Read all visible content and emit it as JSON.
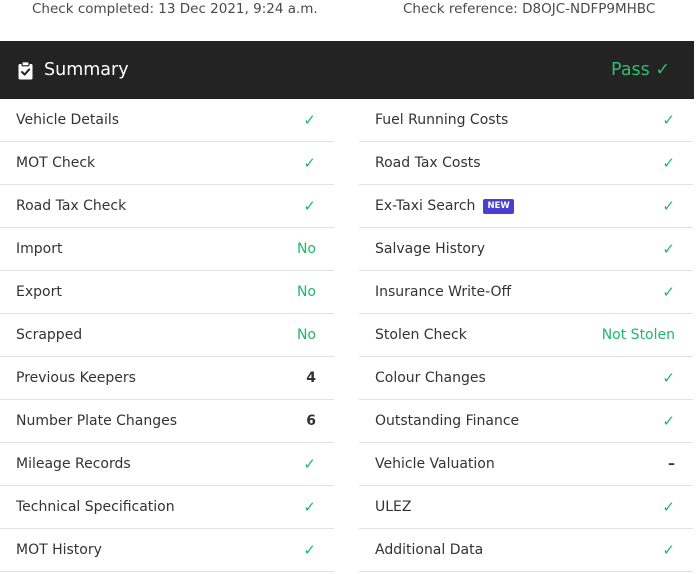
{
  "meta": {
    "completed": "Check completed: 13 Dec 2021, 9:24 a.m.",
    "reference": "Check reference: D8OJC-NDFP9MHBC"
  },
  "summary": {
    "title": "Summary",
    "status": "Pass ✓",
    "status_color": "#2dbf6e",
    "header_bg": "#232323",
    "icon": "clipboard-check-icon"
  },
  "left_rows": [
    {
      "label": "Vehicle Details",
      "value": "✓",
      "kind": "ok"
    },
    {
      "label": "MOT Check",
      "value": "✓",
      "kind": "ok"
    },
    {
      "label": "Road Tax Check",
      "value": "✓",
      "kind": "ok"
    },
    {
      "label": "Import",
      "value": "No",
      "kind": "green"
    },
    {
      "label": "Export",
      "value": "No",
      "kind": "green"
    },
    {
      "label": "Scrapped",
      "value": "No",
      "kind": "green"
    },
    {
      "label": "Previous Keepers",
      "value": "4",
      "kind": "num"
    },
    {
      "label": "Number Plate Changes",
      "value": "6",
      "kind": "num"
    },
    {
      "label": "Mileage Records",
      "value": "✓",
      "kind": "ok"
    },
    {
      "label": "Technical Specification",
      "value": "✓",
      "kind": "ok"
    },
    {
      "label": "MOT History",
      "value": "✓",
      "kind": "ok"
    }
  ],
  "right_rows": [
    {
      "label": "Fuel Running Costs",
      "value": "✓",
      "kind": "ok"
    },
    {
      "label": "Road Tax Costs",
      "value": "✓",
      "kind": "ok"
    },
    {
      "label": "Ex-Taxi Search",
      "badge": "NEW",
      "value": "✓",
      "kind": "ok"
    },
    {
      "label": "Salvage History",
      "value": "✓",
      "kind": "ok"
    },
    {
      "label": "Insurance Write-Off",
      "value": "✓",
      "kind": "ok"
    },
    {
      "label": "Stolen Check",
      "value": "Not Stolen",
      "kind": "green"
    },
    {
      "label": "Colour Changes",
      "value": "✓",
      "kind": "ok"
    },
    {
      "label": "Outstanding Finance",
      "value": "✓",
      "kind": "ok"
    },
    {
      "label": "Vehicle Valuation",
      "value": "–",
      "kind": "dash"
    },
    {
      "label": "ULEZ",
      "value": "✓",
      "kind": "ok"
    },
    {
      "label": "Additional Data",
      "value": "✓",
      "kind": "ok"
    }
  ],
  "colors": {
    "check_green": "#1fb86a",
    "badge_purple": "#4a3fd1"
  }
}
